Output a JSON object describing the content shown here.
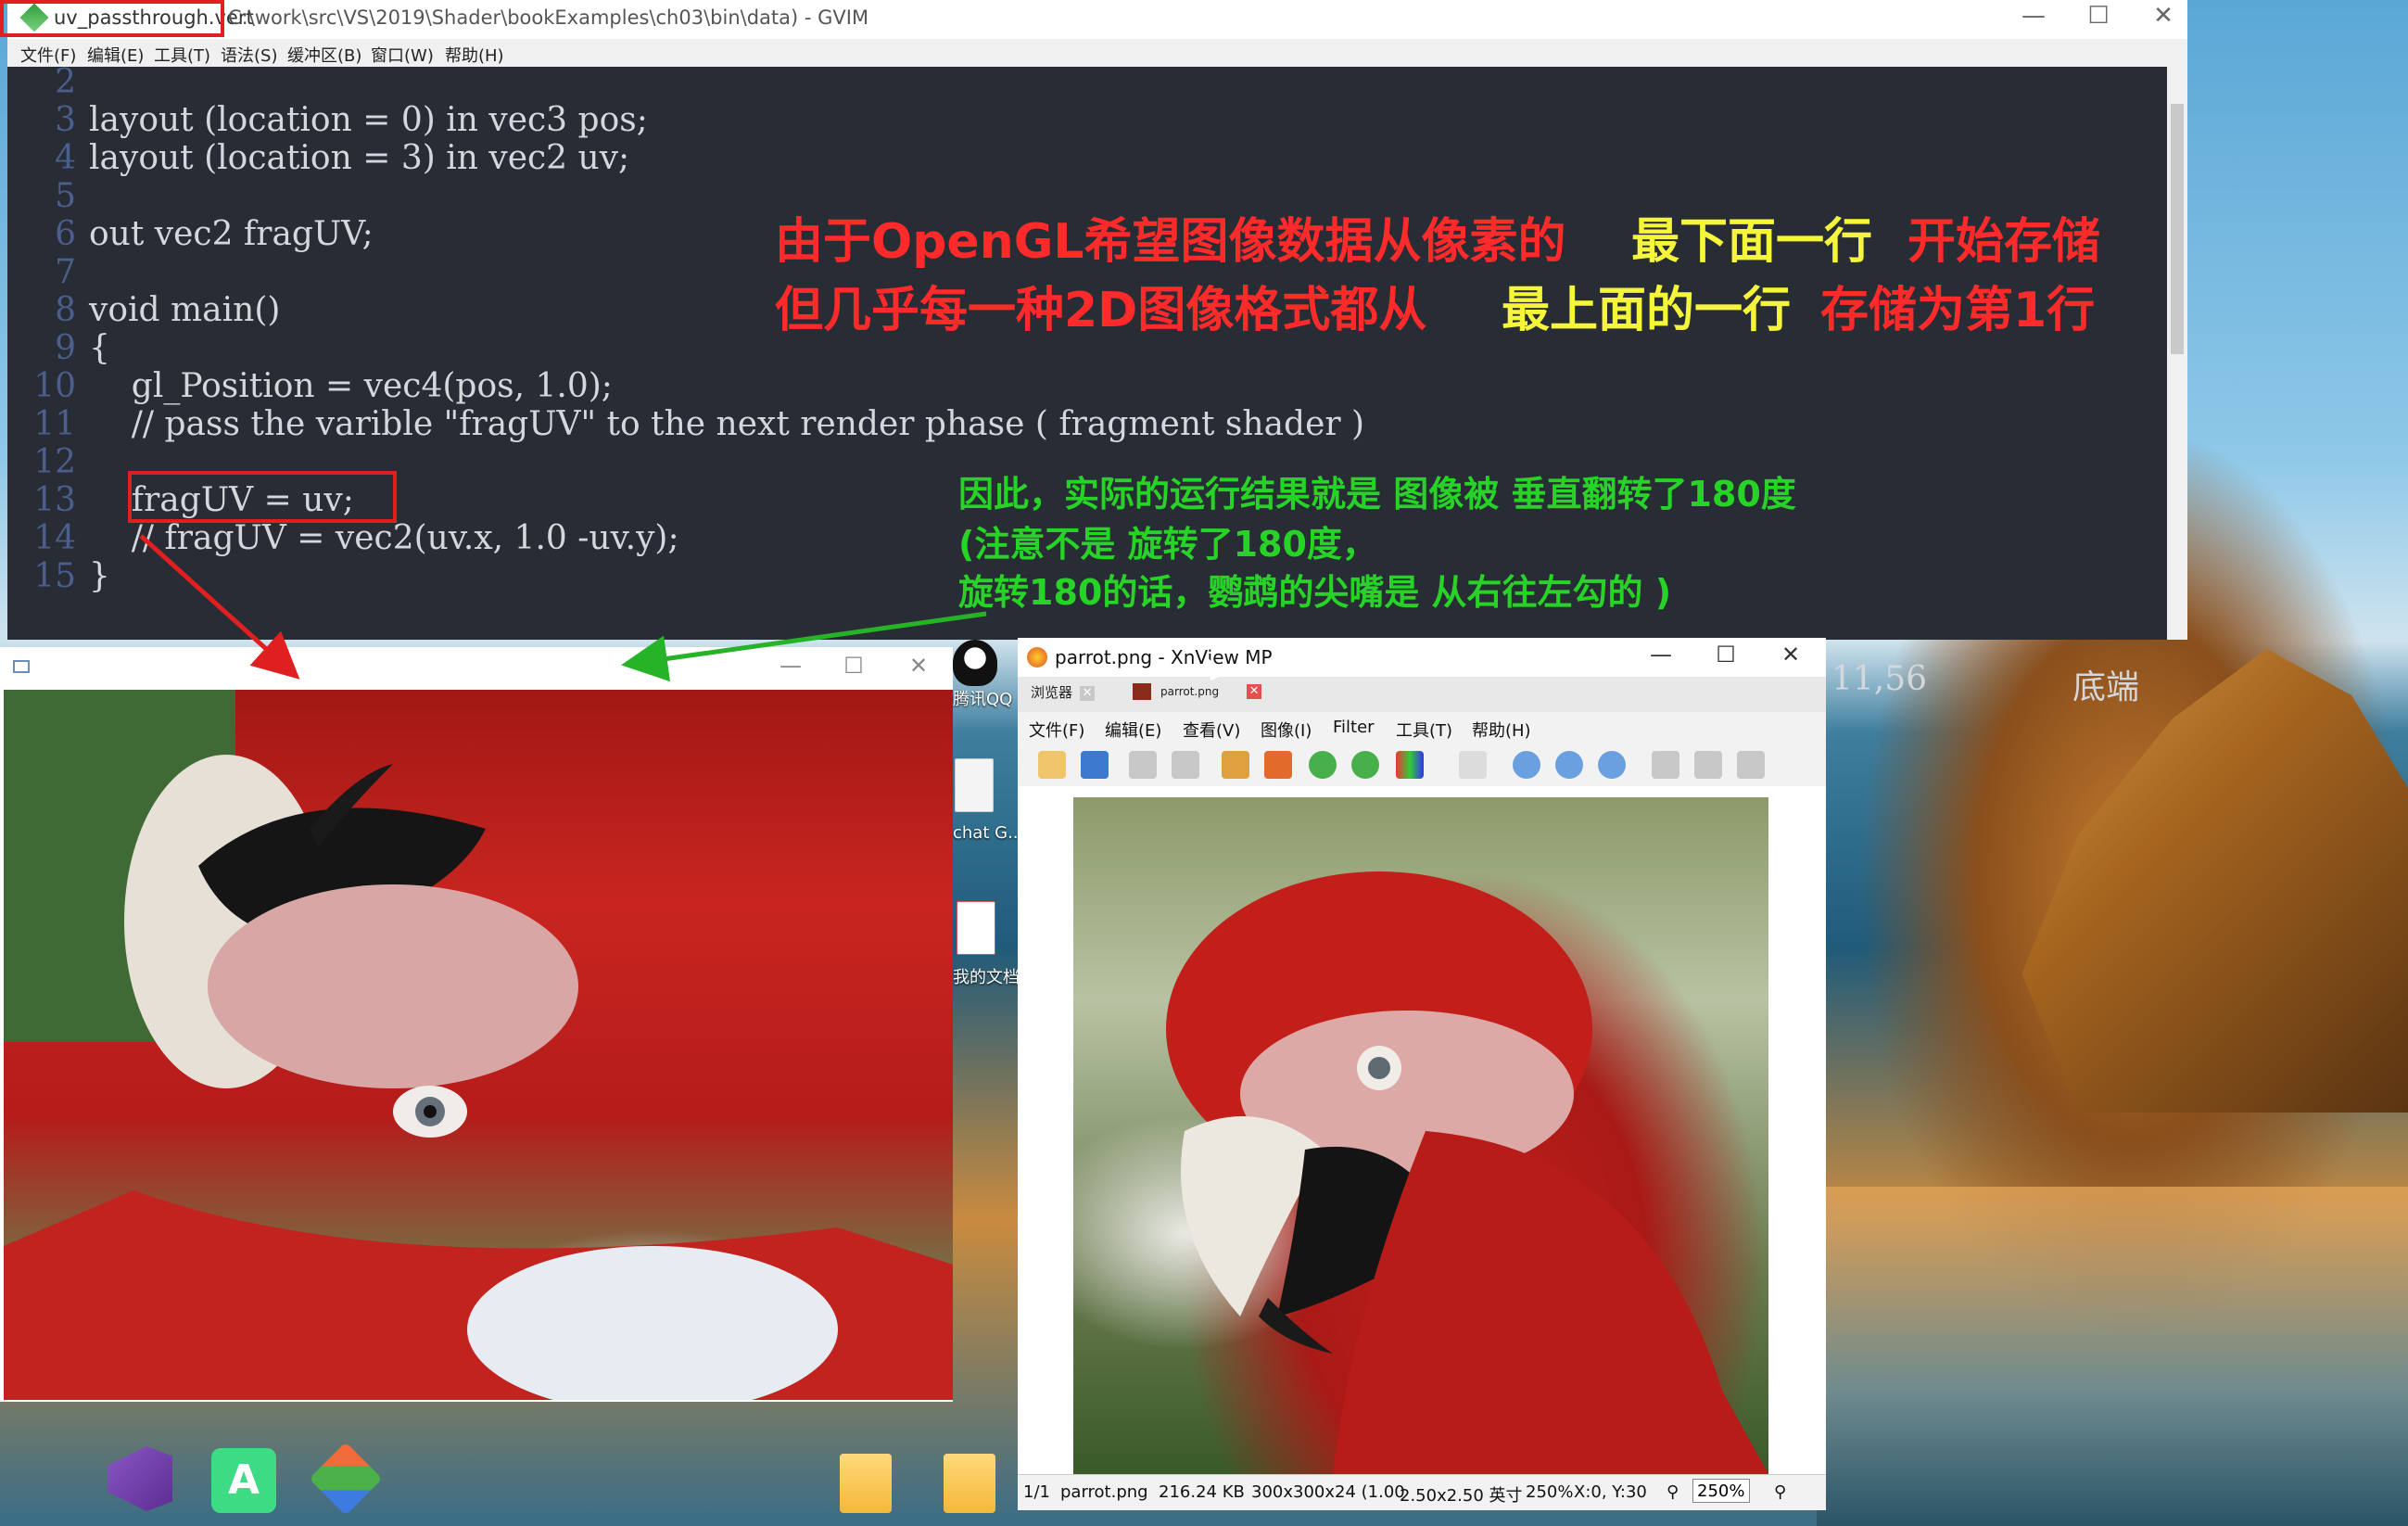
{
  "gvim": {
    "title_file": "uv_passthrough.vert",
    "title_path": "C:\\work\\src\\VS\\2019\\Shader\\bookExamples\\ch03\\bin\\data) - GVIM",
    "menu": [
      "文件(F)",
      "编辑(E)",
      "工具(T)",
      "语法(S)",
      "缓冲区(B)",
      "窗口(W)",
      "帮助(H)"
    ],
    "line_numbers": [
      "2",
      "3",
      "4",
      "5",
      "6",
      "7",
      "8",
      "9",
      "10",
      "11",
      "12",
      "13",
      "14",
      "15"
    ],
    "code": [
      "",
      "layout (location = 0) in vec3 pos;",
      "layout (location = 3) in vec2 uv;",
      "",
      "out vec2 fragUV;",
      "",
      "void main()",
      "{",
      "    gl_Position = vec4(pos, 1.0);",
      "    // pass the varible \"fragUV\" to the next render phase ( fragment shader )",
      "",
      "    fragUV = uv;",
      "    // fragUV = vec2(uv.x, 1.0 -uv.y);",
      "}"
    ],
    "ruler": "11,56",
    "ruler_pos": "底端",
    "controls": {
      "minimize": "—",
      "maximize": "☐",
      "close": "✕"
    }
  },
  "annotations": {
    "red_line1_a": "由于OpenGL希望图像数据从像素的",
    "yellow_line1": "最下面一行",
    "red_line1_b": "开始存储",
    "red_line2_a": "但几乎每一种2D图像格式都从",
    "yellow_line2": "最上面的一行",
    "red_line2_b": "存储为第1行",
    "green_line1": "因此，实际的运行结果就是 图像被 垂直翻转了180度",
    "green_line2": "(注意不是 旋转了180度，",
    "green_line3": "旋转180的话，鹦鹉的尖嘴是 从右往左勾的 )"
  },
  "glwin": {
    "controls": {
      "minimize": "—",
      "maximize": "☐",
      "close": "✕"
    }
  },
  "xnview": {
    "title": "parrot.png - XnView MP",
    "tabs": [
      {
        "label": "浏览器"
      },
      {
        "label": "parrot.png"
      }
    ],
    "menu": [
      "文件(F)",
      "编辑(E)",
      "查看(V)",
      "图像(I)",
      "Filter",
      "工具(T)",
      "帮助(H)"
    ],
    "status": {
      "index": "1/1",
      "filename": "parrot.png",
      "size": "216.24 KB",
      "dims": "300x300x24 (1.00",
      "inches": "2.50x2.50 英寸",
      "zoom_pct": "250%",
      "coords": "X:0, Y:30",
      "zoom_box": "250%"
    },
    "controls": {
      "minimize": "—",
      "maximize": "☐",
      "close": "✕"
    }
  },
  "desktop": {
    "labels": {
      "qq": "腾讯QQ",
      "chat": "chat G...",
      "docs": "我的文档"
    }
  },
  "colors": {
    "editor_bg": "#282c34",
    "annotation_red": "#ff2a2a",
    "annotation_yellow": "#f5f53a",
    "annotation_green": "#27d327",
    "highlight_box": "#e02020"
  }
}
